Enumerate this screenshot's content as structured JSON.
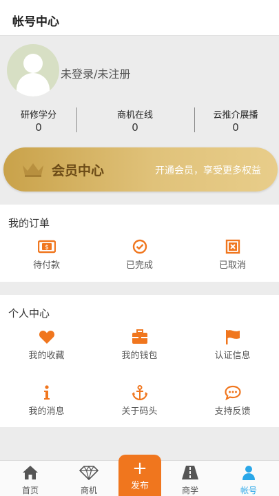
{
  "header": {
    "title": "帐号中心"
  },
  "profile": {
    "login_text": "未登录/未注册",
    "stats": [
      {
        "label": "研修学分",
        "value": "0"
      },
      {
        "label": "商机在线",
        "value": "0"
      },
      {
        "label": "云推介展播",
        "value": "0"
      }
    ]
  },
  "vip": {
    "title": "会员中心",
    "subtitle": "开通会员，享受更多权益"
  },
  "orders": {
    "title": "我的订单",
    "items": [
      {
        "label": "待付款",
        "icon": "payment-icon"
      },
      {
        "label": "已完成",
        "icon": "check-circle-icon"
      },
      {
        "label": "已取消",
        "icon": "cancel-box-icon"
      }
    ]
  },
  "personal": {
    "title": "个人中心",
    "items": [
      {
        "label": "我的收藏",
        "icon": "heart-icon"
      },
      {
        "label": "我的钱包",
        "icon": "wallet-icon"
      },
      {
        "label": "认证信息",
        "icon": "flag-icon"
      },
      {
        "label": "我的消息",
        "icon": "info-icon"
      },
      {
        "label": "关于码头",
        "icon": "anchor-icon"
      },
      {
        "label": "支持反馈",
        "icon": "chat-icon"
      }
    ]
  },
  "tabbar": {
    "tabs": [
      {
        "label": "首页",
        "icon": "home-icon"
      },
      {
        "label": "商机",
        "icon": "diamond-icon"
      },
      {
        "label": "发布",
        "icon": "plus-icon"
      },
      {
        "label": "商学",
        "icon": "road-icon"
      },
      {
        "label": "帐号",
        "icon": "user-icon"
      }
    ],
    "active": "帐号"
  },
  "colors": {
    "accent": "#f0761e",
    "active_tab": "#2aa7e8",
    "vip_gold": "#d4b062"
  }
}
